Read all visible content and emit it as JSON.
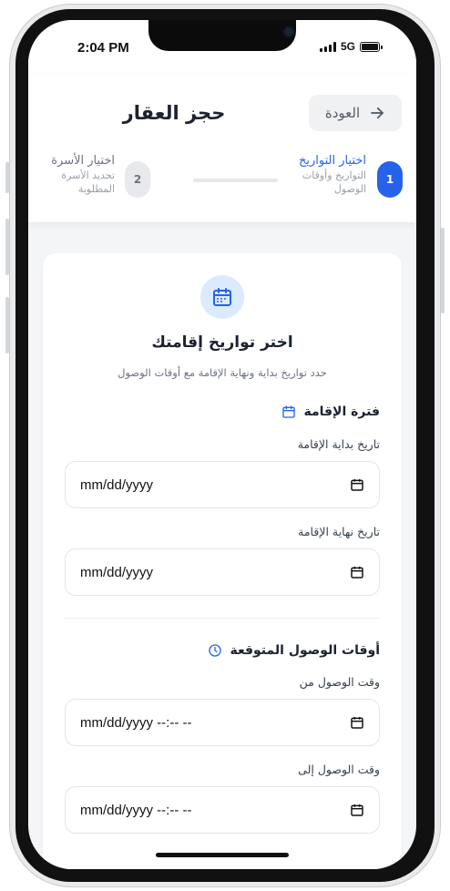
{
  "status_bar": {
    "time": "2:04 PM",
    "network": "5G"
  },
  "header": {
    "title": "حجز العقار",
    "back_label": "العودة"
  },
  "stepper": {
    "steps": [
      {
        "number": "1",
        "title": "اختيار التواريخ",
        "subtitle": "التواريخ وأوقات الوصول",
        "active": true
      },
      {
        "number": "2",
        "title": "اختيار الأسرة",
        "subtitle": "تحديد الأسرة المطلوبة",
        "active": false
      }
    ]
  },
  "card": {
    "title": "اختر تواريخ إقامتك",
    "subtitle": "حدد تواريخ بداية ونهاية الإقامة مع أوقات الوصول",
    "stay_section": {
      "heading": "فترة الإقامة",
      "start_label": "تاريخ بداية الإقامة",
      "start_placeholder": "mm/dd/yyyy",
      "end_label": "تاريخ نهاية الإقامة",
      "end_placeholder": "mm/dd/yyyy"
    },
    "arrival_section": {
      "heading": "أوقات الوصول المتوقعة",
      "from_label": "وقت الوصول من",
      "from_placeholder": "mm/dd/yyyy --:-- --",
      "to_label": "وقت الوصول إلى",
      "to_placeholder": "mm/dd/yyyy --:-- --"
    }
  },
  "colors": {
    "accent": "#2563eb",
    "accent_light": "#dbeafe",
    "text": "#1c2230",
    "muted": "#6b7280"
  },
  "icons": [
    "arrow-right-icon",
    "calendar-icon",
    "clock-icon",
    "calendar-picker-icon"
  ]
}
